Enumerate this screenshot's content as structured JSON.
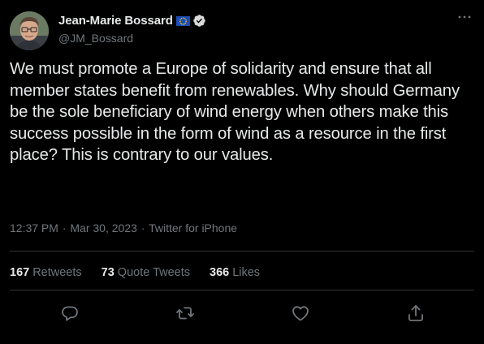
{
  "author": {
    "display_name": "Jean-Marie Bossard",
    "handle": "@JM_Bossard",
    "flag_icon": "eu-flag-icon",
    "verified_icon": "verified-badge-icon"
  },
  "tweet": {
    "text": "We must promote a Europe of solidarity and ensure that all member states benefit from renewables. Why should Germany be the sole beneficiary of wind energy when others make this success possible in the form of wind as a resource in the first place? This is contrary to our values.",
    "time": "12:37 PM",
    "date": "Mar 30, 2023",
    "source": "Twitter for iPhone",
    "separator": "·"
  },
  "stats": {
    "retweets": {
      "count": "167",
      "label": "Retweets"
    },
    "quote_tweets": {
      "count": "73",
      "label": "Quote Tweets"
    },
    "likes": {
      "count": "366",
      "label": "Likes"
    }
  },
  "actions": [
    "reply-icon",
    "retweet-icon",
    "like-icon",
    "share-icon"
  ],
  "colors": {
    "background": "#000000",
    "text_primary": "#e7e9ea",
    "text_secondary": "#71767b",
    "divider": "#2f3336"
  }
}
